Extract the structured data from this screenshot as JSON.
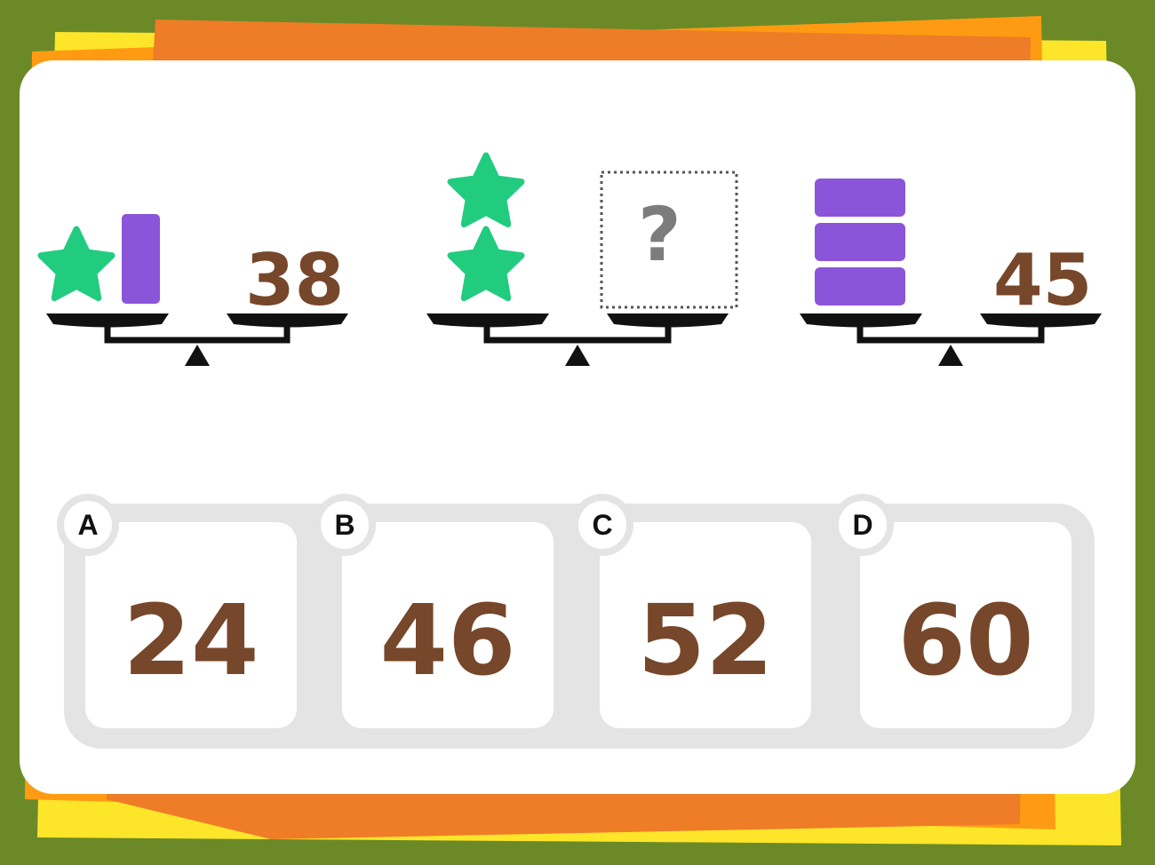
{
  "colors": {
    "background": "#6b8a27",
    "card": "#ffffff",
    "star": "#21cc7f",
    "block": "#8b55d9",
    "number": "#76472a",
    "scale": "#111111",
    "question_mark": "#7c7c7c",
    "answer_tray": "#e4e4e4",
    "paper_orange": "#ef7c27",
    "paper_amber": "#ff9b12",
    "paper_yellow": "#fde52a"
  },
  "puzzle": {
    "scale_1": {
      "left_pan": [
        "star",
        "bar"
      ],
      "right_pan": "38"
    },
    "scale_2": {
      "left_pan": [
        "star",
        "star"
      ],
      "right_pan": "?"
    },
    "scale_3": {
      "left_pan": [
        "bar",
        "bar",
        "bar"
      ],
      "right_pan": "45"
    }
  },
  "options": [
    {
      "letter": "A",
      "value": "24"
    },
    {
      "letter": "B",
      "value": "46"
    },
    {
      "letter": "C",
      "value": "52"
    },
    {
      "letter": "D",
      "value": "60"
    }
  ]
}
